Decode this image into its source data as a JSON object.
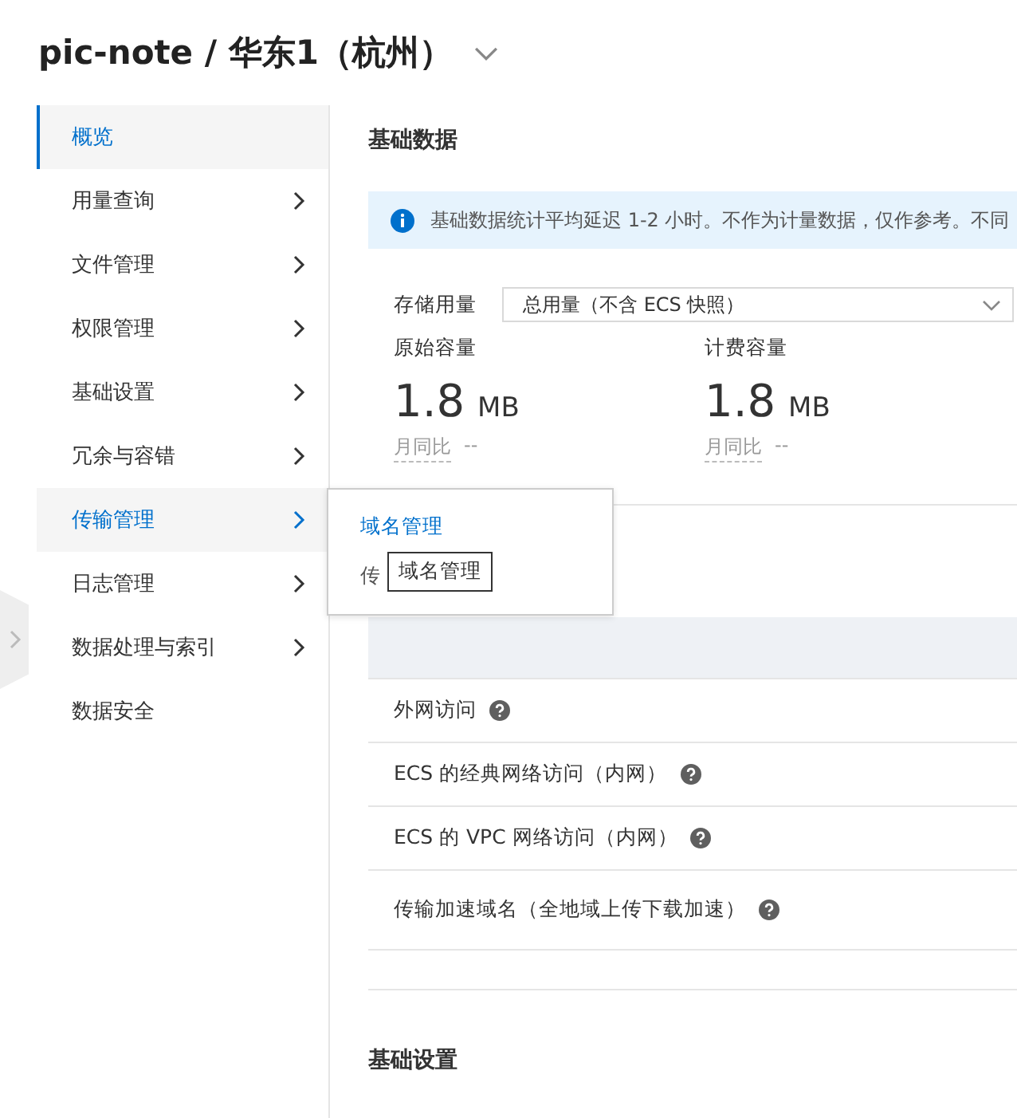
{
  "header": {
    "title": "pic-note / 华东1（杭州）"
  },
  "sidebar": {
    "items": [
      {
        "label": "概览",
        "selected": true,
        "has_children": false
      },
      {
        "label": "用量查询",
        "selected": false,
        "has_children": true
      },
      {
        "label": "文件管理",
        "selected": false,
        "has_children": true
      },
      {
        "label": "权限管理",
        "selected": false,
        "has_children": true
      },
      {
        "label": "基础设置",
        "selected": false,
        "has_children": true
      },
      {
        "label": "冗余与容错",
        "selected": false,
        "has_children": true
      },
      {
        "label": "传输管理",
        "selected": false,
        "has_children": true,
        "expanded": true
      },
      {
        "label": "日志管理",
        "selected": false,
        "has_children": true
      },
      {
        "label": "数据处理与索引",
        "selected": false,
        "has_children": true
      },
      {
        "label": "数据安全",
        "selected": false,
        "has_children": false
      }
    ]
  },
  "submenu": {
    "items": [
      {
        "label": "域名管理",
        "selected": true
      },
      {
        "label": "传",
        "selected": false
      }
    ],
    "tooltip": "域名管理"
  },
  "main": {
    "section_title": "基础数据",
    "notice": "基础数据统计平均延迟 1-2 小时。不作为计量数据，仅作参考。不同",
    "storage": {
      "label": "存储用量",
      "value": "总用量（不含 ECS 快照）"
    },
    "metrics": [
      {
        "label": "原始容量",
        "value": "1.8",
        "unit": "MB",
        "compare_label": "月同比",
        "compare_value": "--"
      },
      {
        "label": "计费容量",
        "value": "1.8",
        "unit": "MB",
        "compare_label": "月同比",
        "compare_value": "--"
      }
    ],
    "access_rows": [
      "外网访问",
      "ECS 的经典网络访问（内网）",
      "ECS 的 VPC 网络访问（内网）",
      "传输加速域名（全地域上传下载加速）"
    ],
    "next_section_title": "基础设置"
  }
}
